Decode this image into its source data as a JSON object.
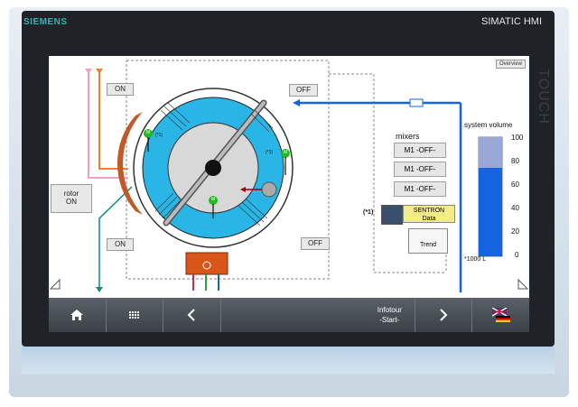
{
  "device": {
    "brand": "SIEMENS",
    "model": "SIMATIC HMI",
    "touch_label": "TOUCH"
  },
  "screen": {
    "overview_button": "Overview",
    "valves": {
      "top_left": "ON",
      "top_right": "OFF",
      "bottom_left": "ON",
      "bottom_right": "OFF"
    },
    "rotor": {
      "line1": "rotor",
      "line2": "ON"
    },
    "mixers_title": "mixers",
    "mixers": [
      "M1 -OFF-",
      "M1 -OFF-",
      "M1 -OFF-"
    ],
    "footnote_marker": "(*1)",
    "motor_badge": "M",
    "motor_footnote": "(*1)",
    "sentron": {
      "line1": "SENTRON",
      "line2": "Data"
    },
    "trend_label": "Trend",
    "system_volume": {
      "title": "system volume",
      "ticks": [
        "100",
        "80",
        "60",
        "40",
        "20",
        "0"
      ],
      "unit": "*1000 L",
      "level_fraction": 0.75,
      "upper_fraction": 0.21
    }
  },
  "taskbar": {
    "home_icon": "home-icon",
    "menu_icon": "menu-grid-icon",
    "back_icon": "chevron-left-icon",
    "infotour_line1": "Infotour",
    "infotour_line2": "-Start-",
    "forward_icon": "chevron-right-icon",
    "language_icon": "language-flags-icon"
  },
  "colors": {
    "tank_blue": "#1565e0",
    "rotor_cyan": "#29b6e6",
    "accent_teal": "#35b3b0"
  }
}
